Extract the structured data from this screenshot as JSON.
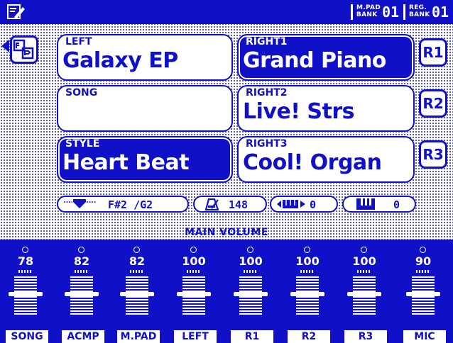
{
  "header": {
    "mpad_label_1": "M.PAD",
    "mpad_label_2": "BANK",
    "mpad_value": "01",
    "reg_label_1": "REG.",
    "reg_label_2": "BANK",
    "reg_value": "01"
  },
  "voices": {
    "left": {
      "title": "LEFT",
      "name": "Galaxy EP"
    },
    "song": {
      "title": "SONG",
      "name": ""
    },
    "style": {
      "title": "STYLE",
      "name": "Heart Beat"
    },
    "right1": {
      "title": "RIGHT1",
      "name": "Grand Piano"
    },
    "right2": {
      "title": "RIGHT2",
      "name": "Live! Strs"
    },
    "right3": {
      "title": "RIGHT3",
      "name": "Cool! Organ"
    }
  },
  "part_buttons": [
    "R1",
    "R2",
    "R3"
  ],
  "info": {
    "key": "F#2 /G2",
    "tempo": "148",
    "transpose": "0",
    "octave": "0"
  },
  "mixer": {
    "title": "MAIN VOLUME",
    "channels": [
      {
        "name": "SONG",
        "value": "78"
      },
      {
        "name": "ACMP",
        "value": "82"
      },
      {
        "name": "M.PAD",
        "value": "82"
      },
      {
        "name": "LEFT",
        "value": "100"
      },
      {
        "name": "R1",
        "value": "100"
      },
      {
        "name": "R2",
        "value": "100"
      },
      {
        "name": "R3",
        "value": "100"
      },
      {
        "name": "MIC",
        "value": "90"
      }
    ]
  }
}
